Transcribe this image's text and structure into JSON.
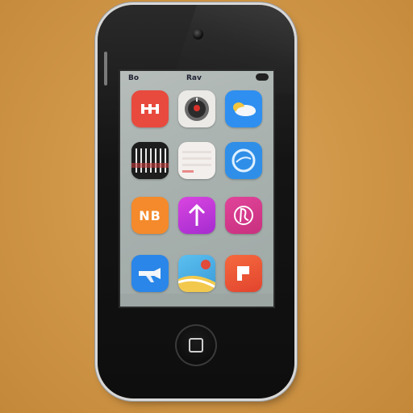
{
  "status_bar": {
    "left_text": "Bo",
    "center_text": "Rav"
  },
  "apps": [
    {
      "name": "app-red",
      "label": "",
      "color": "#e84a3e",
      "icon": "grid-glyph-icon"
    },
    {
      "name": "app-compass",
      "label": "",
      "color": "#eceae6",
      "icon": "dial-icon"
    },
    {
      "name": "app-blue-weather",
      "label": "",
      "color": "#2e8ff0",
      "icon": "cloud-sun-icon"
    },
    {
      "name": "app-piano",
      "label": "",
      "color": "#222222",
      "icon": "piano-keys-icon"
    },
    {
      "name": "app-notes",
      "label": "",
      "color": "#f3efec",
      "icon": "notes-lines-icon"
    },
    {
      "name": "app-browser",
      "label": "",
      "color": "#2f8fe8",
      "icon": "globe-icon"
    },
    {
      "name": "app-orange",
      "label": "NB",
      "color": "#f48a2b",
      "icon": "text-logo-icon"
    },
    {
      "name": "app-purple-arrow",
      "label": "",
      "color": "#c136d8",
      "icon": "arrow-up-icon"
    },
    {
      "name": "app-pink-script",
      "label": "",
      "color": "#d83a8c",
      "icon": "script-glyph-icon"
    },
    {
      "name": "app-blue-plane",
      "label": "",
      "color": "#2a86e8",
      "icon": "plane-icon"
    },
    {
      "name": "app-map",
      "label": "",
      "color": "#4ab0e8",
      "icon": "map-icon"
    },
    {
      "name": "app-red-square",
      "label": "",
      "color": "#f05a3a",
      "icon": "square-glyph-icon"
    }
  ],
  "orange_app_text": "NB"
}
